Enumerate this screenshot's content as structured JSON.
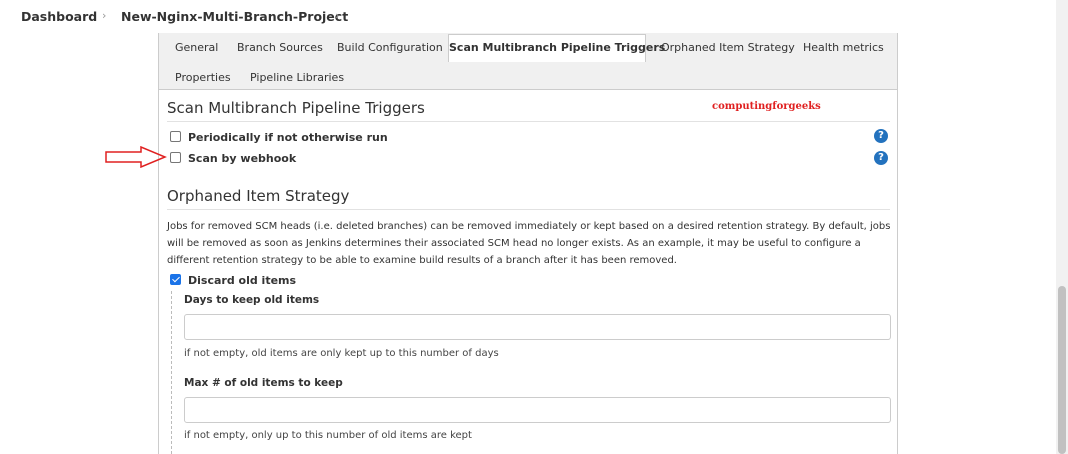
{
  "breadcrumb": {
    "items": [
      "Dashboard",
      "New-Nginx-Multi-Branch-Project"
    ],
    "separator": "›"
  },
  "tabs": {
    "row1": [
      "General",
      "Branch Sources",
      "Build Configuration",
      "Scan Multibranch Pipeline Triggers",
      "Orphaned Item Strategy",
      "Health metrics"
    ],
    "row2": [
      "Properties",
      "Pipeline Libraries"
    ],
    "active": "Scan Multibranch Pipeline Triggers"
  },
  "scan_triggers": {
    "title": "Scan Multibranch Pipeline Triggers",
    "options": [
      {
        "label": "Periodically if not otherwise run",
        "checked": false
      },
      {
        "label": "Scan by webhook",
        "checked": false
      }
    ],
    "help_glyph": "?"
  },
  "watermark": "computingforgeeks",
  "orphaned": {
    "title": "Orphaned Item Strategy",
    "description": "Jobs for removed SCM heads (i.e. deleted branches) can be removed immediately or kept based on a desired retention strategy. By default, jobs will be removed as soon as Jenkins determines their associated SCM head no longer exists. As an example, it may be useful to configure a different retention strategy to be able to examine build results of a branch after it has been removed.",
    "discard": {
      "label": "Discard old items",
      "checked": true
    },
    "days_field": {
      "label": "Days to keep old items",
      "value": "",
      "hint": "if not empty, old items are only kept up to this number of days"
    },
    "max_field": {
      "label": "Max # of old items to keep",
      "value": "",
      "hint": "if not empty, only up to this number of old items are kept"
    }
  },
  "colors": {
    "accent": "#2372be",
    "annotation": "#e02020",
    "tabbar_bg": "#f0f0f0"
  },
  "icons": [
    "chevron-right-icon",
    "help-icon",
    "checkbox-icon",
    "red-arrow-annotation"
  ]
}
